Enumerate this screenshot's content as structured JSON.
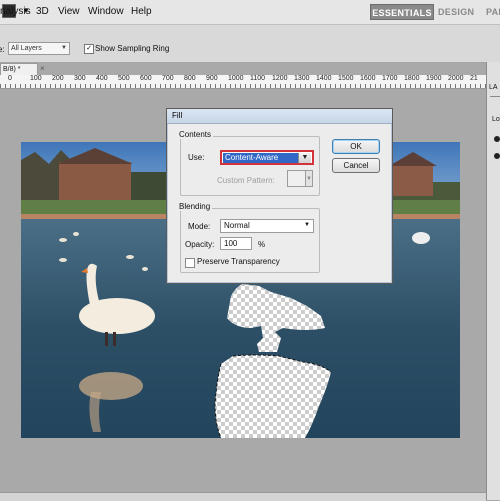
{
  "menubar": {
    "items": [
      "nalysis",
      "3D",
      "View",
      "Window",
      "Help"
    ],
    "workspaces": [
      "ESSENTIALS",
      "DESIGN",
      "PAI"
    ]
  },
  "options": {
    "sample_label": "e:",
    "sample_value": "All Layers",
    "ring_label": "Show Sampling Ring",
    "ring_checked": true
  },
  "document": {
    "tab_label": "B/8) *",
    "ruler_ticks": [
      "0",
      "100",
      "200",
      "300",
      "400",
      "500",
      "600",
      "700",
      "800",
      "900",
      "1000",
      "1100",
      "1200",
      "1300",
      "1400",
      "1500",
      "1600",
      "1700",
      "1800",
      "1900",
      "2000",
      "21"
    ]
  },
  "right_panel": {
    "header": "LA",
    "layers_label": "Lo"
  },
  "dialog": {
    "title": "Fill",
    "contents_legend": "Contents",
    "use_label": "Use:",
    "use_value": "Content-Aware",
    "custom_pattern_label": "Custom Pattern:",
    "blending_legend": "Blending",
    "mode_label": "Mode:",
    "mode_value": "Normal",
    "opacity_label": "Opacity:",
    "opacity_value": "100",
    "opacity_unit": "%",
    "preserve_label": "Preserve Transparency",
    "preserve_checked": false,
    "ok_label": "OK",
    "cancel_label": "Cancel"
  },
  "colors": {
    "use_highlight": "#d2333b",
    "selection_blue": "#3168c6",
    "water": "#2d4f66"
  },
  "icons": [
    "photoshop-logo-icon",
    "chevron-down-icon",
    "checkbox-icon",
    "close-icon"
  ]
}
